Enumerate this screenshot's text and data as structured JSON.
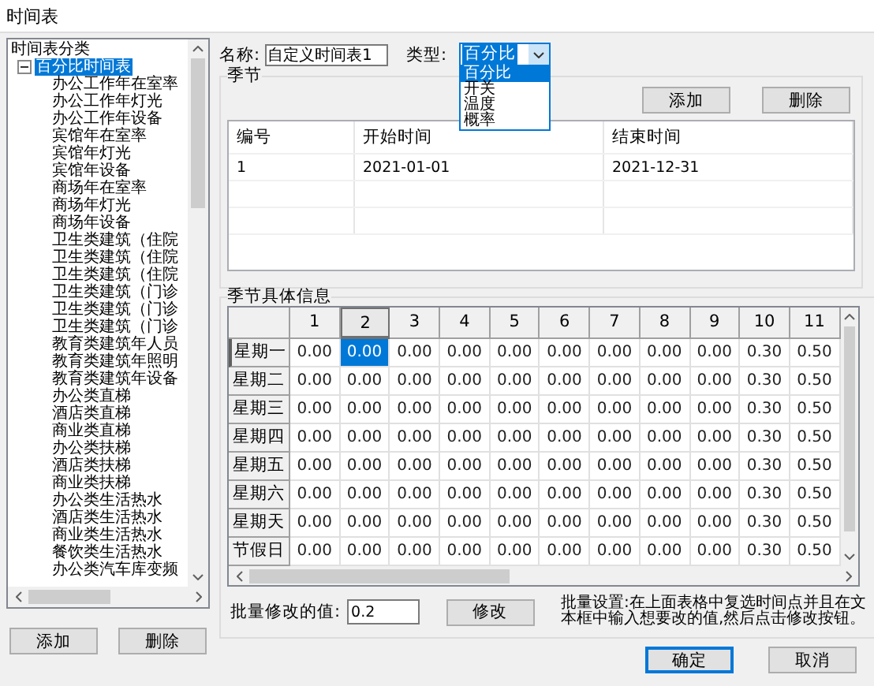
{
  "window": {
    "title": "时间表"
  },
  "tree": {
    "label": "时间表分类",
    "children": [
      {
        "label": "百分比时间表",
        "expanded": true,
        "selected": true,
        "children": [
          {
            "label": "办公工作年在室率"
          },
          {
            "label": "办公工作年灯光"
          },
          {
            "label": "办公工作年设备"
          },
          {
            "label": "宾馆年在室率"
          },
          {
            "label": "宾馆年灯光"
          },
          {
            "label": "宾馆年设备"
          },
          {
            "label": "商场年在室率"
          },
          {
            "label": "商场年灯光"
          },
          {
            "label": "商场年设备"
          },
          {
            "label": "卫生类建筑（住院"
          },
          {
            "label": "卫生类建筑（住院"
          },
          {
            "label": "卫生类建筑（住院"
          },
          {
            "label": "卫生类建筑（门诊"
          },
          {
            "label": "卫生类建筑（门诊"
          },
          {
            "label": "卫生类建筑（门诊"
          },
          {
            "label": "教育类建筑年人员"
          },
          {
            "label": "教育类建筑年照明"
          },
          {
            "label": "教育类建筑年设备"
          },
          {
            "label": "办公类直梯"
          },
          {
            "label": "酒店类直梯"
          },
          {
            "label": "商业类直梯"
          },
          {
            "label": "办公类扶梯"
          },
          {
            "label": "酒店类扶梯"
          },
          {
            "label": "商业类扶梯"
          },
          {
            "label": "办公类生活热水"
          },
          {
            "label": "酒店类生活热水"
          },
          {
            "label": "商业类生活热水"
          },
          {
            "label": "餐饮类生活热水"
          },
          {
            "label": "办公类汽车库变频"
          }
        ]
      }
    ]
  },
  "tree_buttons": [
    "添加",
    "删除"
  ],
  "name": {
    "label": "名称:",
    "value": "自定义时间表1"
  },
  "type": {
    "label": "类型:",
    "value": "百分比",
    "expanded": true,
    "options": [
      {
        "label": "百分比",
        "selected": true
      },
      {
        "label": "开关",
        "selected": false
      },
      {
        "label": "温度",
        "selected": false
      },
      {
        "label": "概率",
        "selected": false
      }
    ]
  },
  "season": {
    "title": "季节",
    "buttons": [
      "添加",
      "删除"
    ],
    "columns": [
      "编号",
      "开始时间",
      "结束时间"
    ],
    "rows": [
      [
        "1",
        "2021-01-01",
        "2021-12-31"
      ]
    ]
  },
  "detail": {
    "title": "季节具体信息",
    "columns": [
      {
        "label": "1",
        "selected": false
      },
      {
        "label": "2",
        "selected": true
      },
      {
        "label": "3",
        "selected": false
      },
      {
        "label": "4",
        "selected": false
      },
      {
        "label": "5",
        "selected": false
      },
      {
        "label": "6",
        "selected": false
      },
      {
        "label": "7",
        "selected": false
      },
      {
        "label": "8",
        "selected": false
      },
      {
        "label": "9",
        "selected": false
      },
      {
        "label": "10",
        "selected": false
      },
      {
        "label": "11",
        "selected": false
      }
    ],
    "rows": [
      {
        "label": "星期一",
        "selected": true,
        "cells": [
          {
            "value": "0.00",
            "selected": false
          },
          {
            "value": "0.00",
            "selected": true
          },
          {
            "value": "0.00",
            "selected": false
          },
          {
            "value": "0.00",
            "selected": false
          },
          {
            "value": "0.00",
            "selected": false
          },
          {
            "value": "0.00",
            "selected": false
          },
          {
            "value": "0.00",
            "selected": false
          },
          {
            "value": "0.00",
            "selected": false
          },
          {
            "value": "0.00",
            "selected": false
          },
          {
            "value": "0.30",
            "selected": false
          },
          {
            "value": "0.50",
            "selected": false
          }
        ]
      },
      {
        "label": "星期二",
        "selected": false,
        "cells": [
          {
            "value": "0.00",
            "selected": false
          },
          {
            "value": "0.00",
            "selected": false
          },
          {
            "value": "0.00",
            "selected": false
          },
          {
            "value": "0.00",
            "selected": false
          },
          {
            "value": "0.00",
            "selected": false
          },
          {
            "value": "0.00",
            "selected": false
          },
          {
            "value": "0.00",
            "selected": false
          },
          {
            "value": "0.00",
            "selected": false
          },
          {
            "value": "0.00",
            "selected": false
          },
          {
            "value": "0.30",
            "selected": false
          },
          {
            "value": "0.50",
            "selected": false
          }
        ]
      },
      {
        "label": "星期三",
        "selected": false,
        "cells": [
          {
            "value": "0.00",
            "selected": false
          },
          {
            "value": "0.00",
            "selected": false
          },
          {
            "value": "0.00",
            "selected": false
          },
          {
            "value": "0.00",
            "selected": false
          },
          {
            "value": "0.00",
            "selected": false
          },
          {
            "value": "0.00",
            "selected": false
          },
          {
            "value": "0.00",
            "selected": false
          },
          {
            "value": "0.00",
            "selected": false
          },
          {
            "value": "0.00",
            "selected": false
          },
          {
            "value": "0.30",
            "selected": false
          },
          {
            "value": "0.50",
            "selected": false
          }
        ]
      },
      {
        "label": "星期四",
        "selected": false,
        "cells": [
          {
            "value": "0.00",
            "selected": false
          },
          {
            "value": "0.00",
            "selected": false
          },
          {
            "value": "0.00",
            "selected": false
          },
          {
            "value": "0.00",
            "selected": false
          },
          {
            "value": "0.00",
            "selected": false
          },
          {
            "value": "0.00",
            "selected": false
          },
          {
            "value": "0.00",
            "selected": false
          },
          {
            "value": "0.00",
            "selected": false
          },
          {
            "value": "0.00",
            "selected": false
          },
          {
            "value": "0.30",
            "selected": false
          },
          {
            "value": "0.50",
            "selected": false
          }
        ]
      },
      {
        "label": "星期五",
        "selected": false,
        "cells": [
          {
            "value": "0.00",
            "selected": false
          },
          {
            "value": "0.00",
            "selected": false
          },
          {
            "value": "0.00",
            "selected": false
          },
          {
            "value": "0.00",
            "selected": false
          },
          {
            "value": "0.00",
            "selected": false
          },
          {
            "value": "0.00",
            "selected": false
          },
          {
            "value": "0.00",
            "selected": false
          },
          {
            "value": "0.00",
            "selected": false
          },
          {
            "value": "0.00",
            "selected": false
          },
          {
            "value": "0.30",
            "selected": false
          },
          {
            "value": "0.50",
            "selected": false
          }
        ]
      },
      {
        "label": "星期六",
        "selected": false,
        "cells": [
          {
            "value": "0.00",
            "selected": false
          },
          {
            "value": "0.00",
            "selected": false
          },
          {
            "value": "0.00",
            "selected": false
          },
          {
            "value": "0.00",
            "selected": false
          },
          {
            "value": "0.00",
            "selected": false
          },
          {
            "value": "0.00",
            "selected": false
          },
          {
            "value": "0.00",
            "selected": false
          },
          {
            "value": "0.00",
            "selected": false
          },
          {
            "value": "0.00",
            "selected": false
          },
          {
            "value": "0.30",
            "selected": false
          },
          {
            "value": "0.50",
            "selected": false
          }
        ]
      },
      {
        "label": "星期天",
        "selected": false,
        "cells": [
          {
            "value": "0.00",
            "selected": false
          },
          {
            "value": "0.00",
            "selected": false
          },
          {
            "value": "0.00",
            "selected": false
          },
          {
            "value": "0.00",
            "selected": false
          },
          {
            "value": "0.00",
            "selected": false
          },
          {
            "value": "0.00",
            "selected": false
          },
          {
            "value": "0.00",
            "selected": false
          },
          {
            "value": "0.00",
            "selected": false
          },
          {
            "value": "0.00",
            "selected": false
          },
          {
            "value": "0.30",
            "selected": false
          },
          {
            "value": "0.50",
            "selected": false
          }
        ]
      },
      {
        "label": "节假日",
        "selected": false,
        "cells": [
          {
            "value": "0.00",
            "selected": false
          },
          {
            "value": "0.00",
            "selected": false
          },
          {
            "value": "0.00",
            "selected": false
          },
          {
            "value": "0.00",
            "selected": false
          },
          {
            "value": "0.00",
            "selected": false
          },
          {
            "value": "0.00",
            "selected": false
          },
          {
            "value": "0.00",
            "selected": false
          },
          {
            "value": "0.00",
            "selected": false
          },
          {
            "value": "0.00",
            "selected": false
          },
          {
            "value": "0.30",
            "selected": false
          },
          {
            "value": "0.50",
            "selected": false
          }
        ]
      }
    ]
  },
  "batch": {
    "label": "批量修改的值:",
    "value": "0.2",
    "button": "修改",
    "hint": "批量设置:在上面表格中复选时间点并且在文本框中输入想要改的值,然后点击修改按钮。"
  },
  "buttons": [
    {
      "label": "确定",
      "default": true
    },
    {
      "label": "取消",
      "default": false
    }
  ]
}
